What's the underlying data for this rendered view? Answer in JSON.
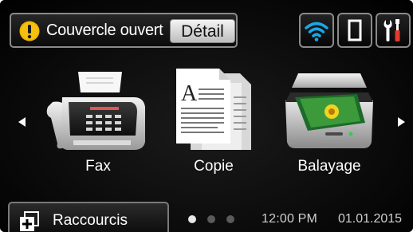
{
  "status": {
    "alert_icon": "warning-icon",
    "alert_color": "#f0b400",
    "message": "Couvercle ouvert",
    "detail_label": "Détail"
  },
  "top_icons": [
    {
      "name": "wifi-icon",
      "color": "#19a7e8"
    },
    {
      "name": "phone-icon",
      "color": "#ffffff"
    },
    {
      "name": "tools-icon",
      "color": "#ffffff",
      "accent": "#e23a2a"
    }
  ],
  "functions": [
    {
      "id": "fax",
      "label": "Fax",
      "icon": "fax-machine-icon"
    },
    {
      "id": "copy",
      "label": "Copie",
      "icon": "copy-documents-icon"
    },
    {
      "id": "scan",
      "label": "Balayage",
      "icon": "scanner-icon"
    }
  ],
  "navigation": {
    "left_arrow": "left-arrow-icon",
    "right_arrow": "right-arrow-icon",
    "page_count": 3,
    "current_page": 1
  },
  "bottom": {
    "shortcuts_label": "Raccourcis",
    "shortcuts_icon": "shortcuts-icon",
    "time": "12:00 PM",
    "date": "01.01.2015"
  }
}
